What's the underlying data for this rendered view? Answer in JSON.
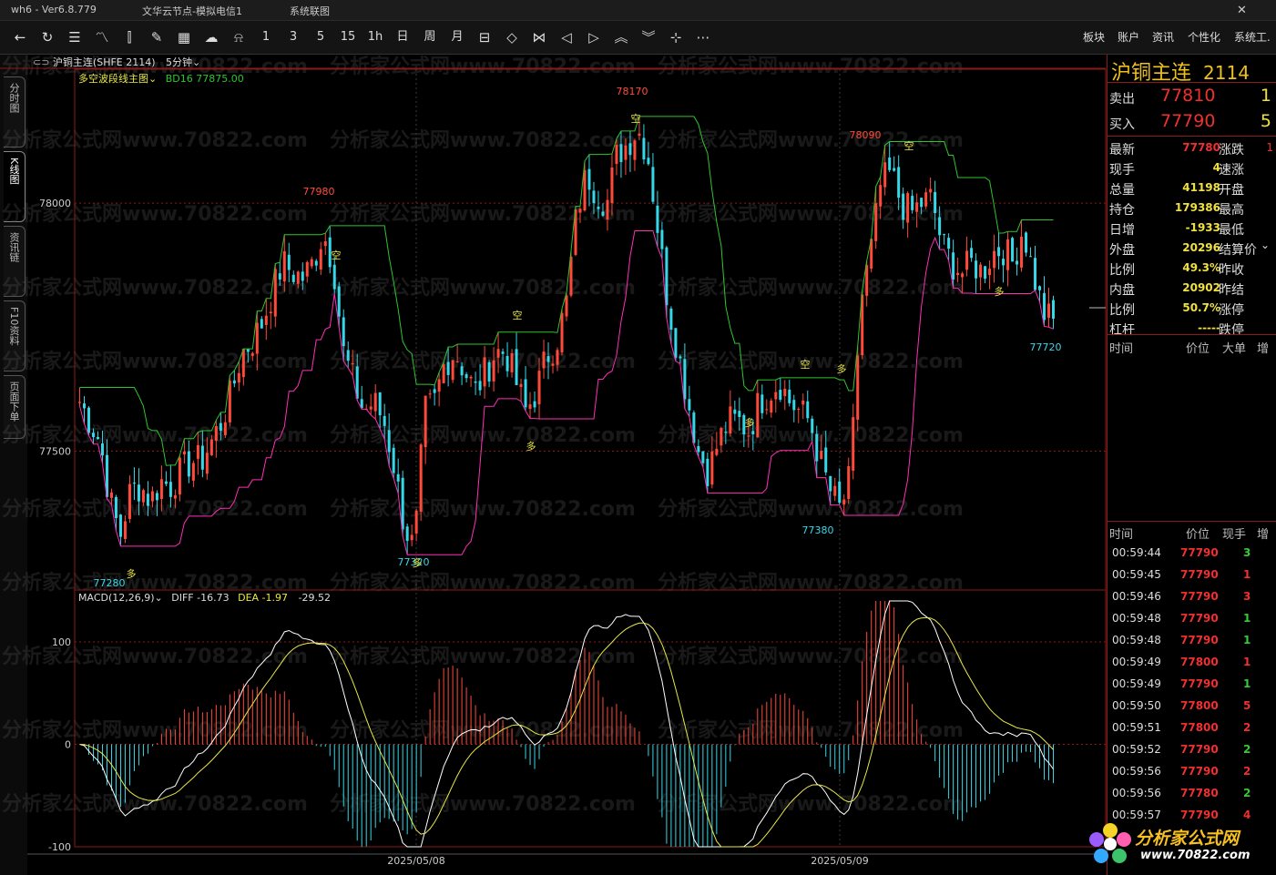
{
  "titlebar": {
    "left": "wh6 - Ver6.8.779",
    "center": "文华云节点-模拟电信1",
    "right": "系统联图"
  },
  "toolbar": {
    "periods": [
      "1",
      "3",
      "5",
      "15",
      "1h",
      "日",
      "周",
      "月"
    ],
    "right": [
      "板块",
      "账户",
      "资讯",
      "个性化",
      "系统工."
    ]
  },
  "leftnav": [
    "分时图",
    "K线图",
    "资讯链",
    "F10资料",
    "页面下单"
  ],
  "chart_header": {
    "symbol": "沪铜主连(SHFE 2114)",
    "period": "5分钟",
    "indicator": "多空波段线主图",
    "bd": "BD16 77875.00"
  },
  "macd_header": {
    "name": "MACD(12,26,9)",
    "diff": "DIFF -16.73",
    "dea": "DEA -1.97",
    "macd": "-29.52"
  },
  "watermark": "分析家公式网www.70822.com",
  "colors": {
    "up": "#ff4a3a",
    "down": "#34d8e8",
    "green_line": "#2ec52e",
    "magenta_line": "#ff2fb8",
    "yellow": "#e8e848",
    "axis_red": "#8b1a1a"
  },
  "chart_data": [
    {
      "type": "candlestick",
      "title": "沪铜主连(SHFE 2114)",
      "y_ticks": [
        77500,
        78000
      ],
      "ylim": [
        77220,
        78270
      ],
      "x_labels": [
        "2025/05/08",
        "2025/05/09"
      ],
      "annotations_high": [
        "77980",
        "78170",
        "78090"
      ],
      "annotations_low": [
        "77280",
        "77320",
        "77380",
        "77720"
      ],
      "signal_labels": [
        "多",
        "空",
        "多",
        "空",
        "多",
        "空",
        "多",
        "空",
        "多",
        "空",
        "多"
      ],
      "ohlc_close_path": [
        77600,
        77560,
        77520,
        77400,
        77330,
        77420,
        77430,
        77400,
        77440,
        77430,
        77460,
        77480,
        77480,
        77520,
        77560,
        77620,
        77700,
        77720,
        77760,
        77820,
        77880,
        77860,
        77850,
        77880,
        77940,
        77880,
        77700,
        77640,
        77580,
        77600,
        77560,
        77470,
        77350,
        77300,
        77580,
        77600,
        77680,
        77700,
        77660,
        77620,
        77660,
        77700,
        77700,
        77640,
        77580,
        77620,
        77690,
        77720,
        77800,
        77980,
        78060,
        78020,
        78000,
        78100,
        78120,
        78150,
        78100,
        77950,
        77800,
        77700,
        77600,
        77500,
        77460,
        77520,
        77560,
        77560,
        77540,
        77600,
        77620,
        77640,
        77600,
        77580,
        77560,
        77480,
        77420,
        77380,
        77450,
        77800,
        77900,
        78040,
        78060,
        78000,
        77980,
        78000,
        78010,
        77920,
        77880,
        77860,
        77880,
        77860,
        77900,
        77910,
        77880,
        77950,
        77860,
        77780,
        77760
      ]
    },
    {
      "type": "bar",
      "title": "MACD(12,26,9)",
      "y_ticks": [
        -100,
        0,
        100
      ],
      "ylim": [
        -100,
        140
      ],
      "series": [
        {
          "name": "DIFF"
        },
        {
          "name": "DEA"
        },
        {
          "name": "MACD"
        }
      ]
    }
  ],
  "quote": {
    "name": "沪铜主连",
    "code": "2114",
    "ask_label": "卖出",
    "ask": "77810",
    "ask_vol": "1",
    "bid_label": "买入",
    "bid": "77790",
    "bid_vol": "5",
    "rows": [
      {
        "l": "最新",
        "v": "77780",
        "vc": "#f03030",
        "l2": "涨跌",
        "v2": "1"
      },
      {
        "l": "现手",
        "v": "4",
        "vc": "#f0e040",
        "l2": "速涨",
        "v2": ""
      },
      {
        "l": "总量",
        "v": "41198",
        "vc": "#f0e040",
        "l2": "开盘",
        "v2": ""
      },
      {
        "l": "持仓",
        "v": "179386",
        "vc": "#f0e040",
        "l2": "最高",
        "v2": ""
      },
      {
        "l": "日增",
        "v": "-1933",
        "vc": "#f0e040",
        "l2": "最低",
        "v2": ""
      },
      {
        "l": "外盘",
        "v": "20296",
        "vc": "#f0e040",
        "l2": "结算价",
        "v2": ""
      },
      {
        "l": "比例",
        "v": "49.3%",
        "vc": "#f0e040",
        "l2": "昨收",
        "v2": ""
      },
      {
        "l": "内盘",
        "v": "20902",
        "vc": "#f0e040",
        "l2": "昨结",
        "v2": ""
      },
      {
        "l": "比例",
        "v": "50.7%",
        "vc": "#f0e040",
        "l2": "涨停",
        "v2": ""
      },
      {
        "l": "杠杆",
        "v": "-----",
        "vc": "#f0e040",
        "l2": "跌停",
        "v2": ""
      }
    ],
    "sec1_hdr": [
      "时间",
      "价位",
      "大单",
      "增"
    ],
    "sec2_hdr": [
      "时间",
      "价位",
      "现手",
      "增"
    ],
    "ticks": [
      {
        "t": "00:59:44",
        "p": "77790",
        "v": "3",
        "c": "#33cc33"
      },
      {
        "t": "00:59:45",
        "p": "77790",
        "v": "1",
        "c": "#f03030"
      },
      {
        "t": "00:59:46",
        "p": "77790",
        "v": "3",
        "c": "#f03030"
      },
      {
        "t": "00:59:48",
        "p": "77790",
        "v": "1",
        "c": "#33cc33"
      },
      {
        "t": "00:59:48",
        "p": "77790",
        "v": "1",
        "c": "#33cc33"
      },
      {
        "t": "00:59:49",
        "p": "77800",
        "v": "1",
        "c": "#f03030"
      },
      {
        "t": "00:59:49",
        "p": "77790",
        "v": "1",
        "c": "#33cc33"
      },
      {
        "t": "00:59:50",
        "p": "77800",
        "v": "5",
        "c": "#f03030"
      },
      {
        "t": "00:59:51",
        "p": "77800",
        "v": "2",
        "c": "#f03030"
      },
      {
        "t": "00:59:52",
        "p": "77790",
        "v": "2",
        "c": "#33cc33"
      },
      {
        "t": "00:59:56",
        "p": "77790",
        "v": "2",
        "c": "#f03030"
      },
      {
        "t": "00:59:56",
        "p": "77780",
        "v": "2",
        "c": "#33cc33"
      },
      {
        "t": "00:59:57",
        "p": "77790",
        "v": "4",
        "c": "#f03030"
      }
    ]
  },
  "logo": {
    "name": "分析家公式网",
    "url": "www.70822.com"
  }
}
